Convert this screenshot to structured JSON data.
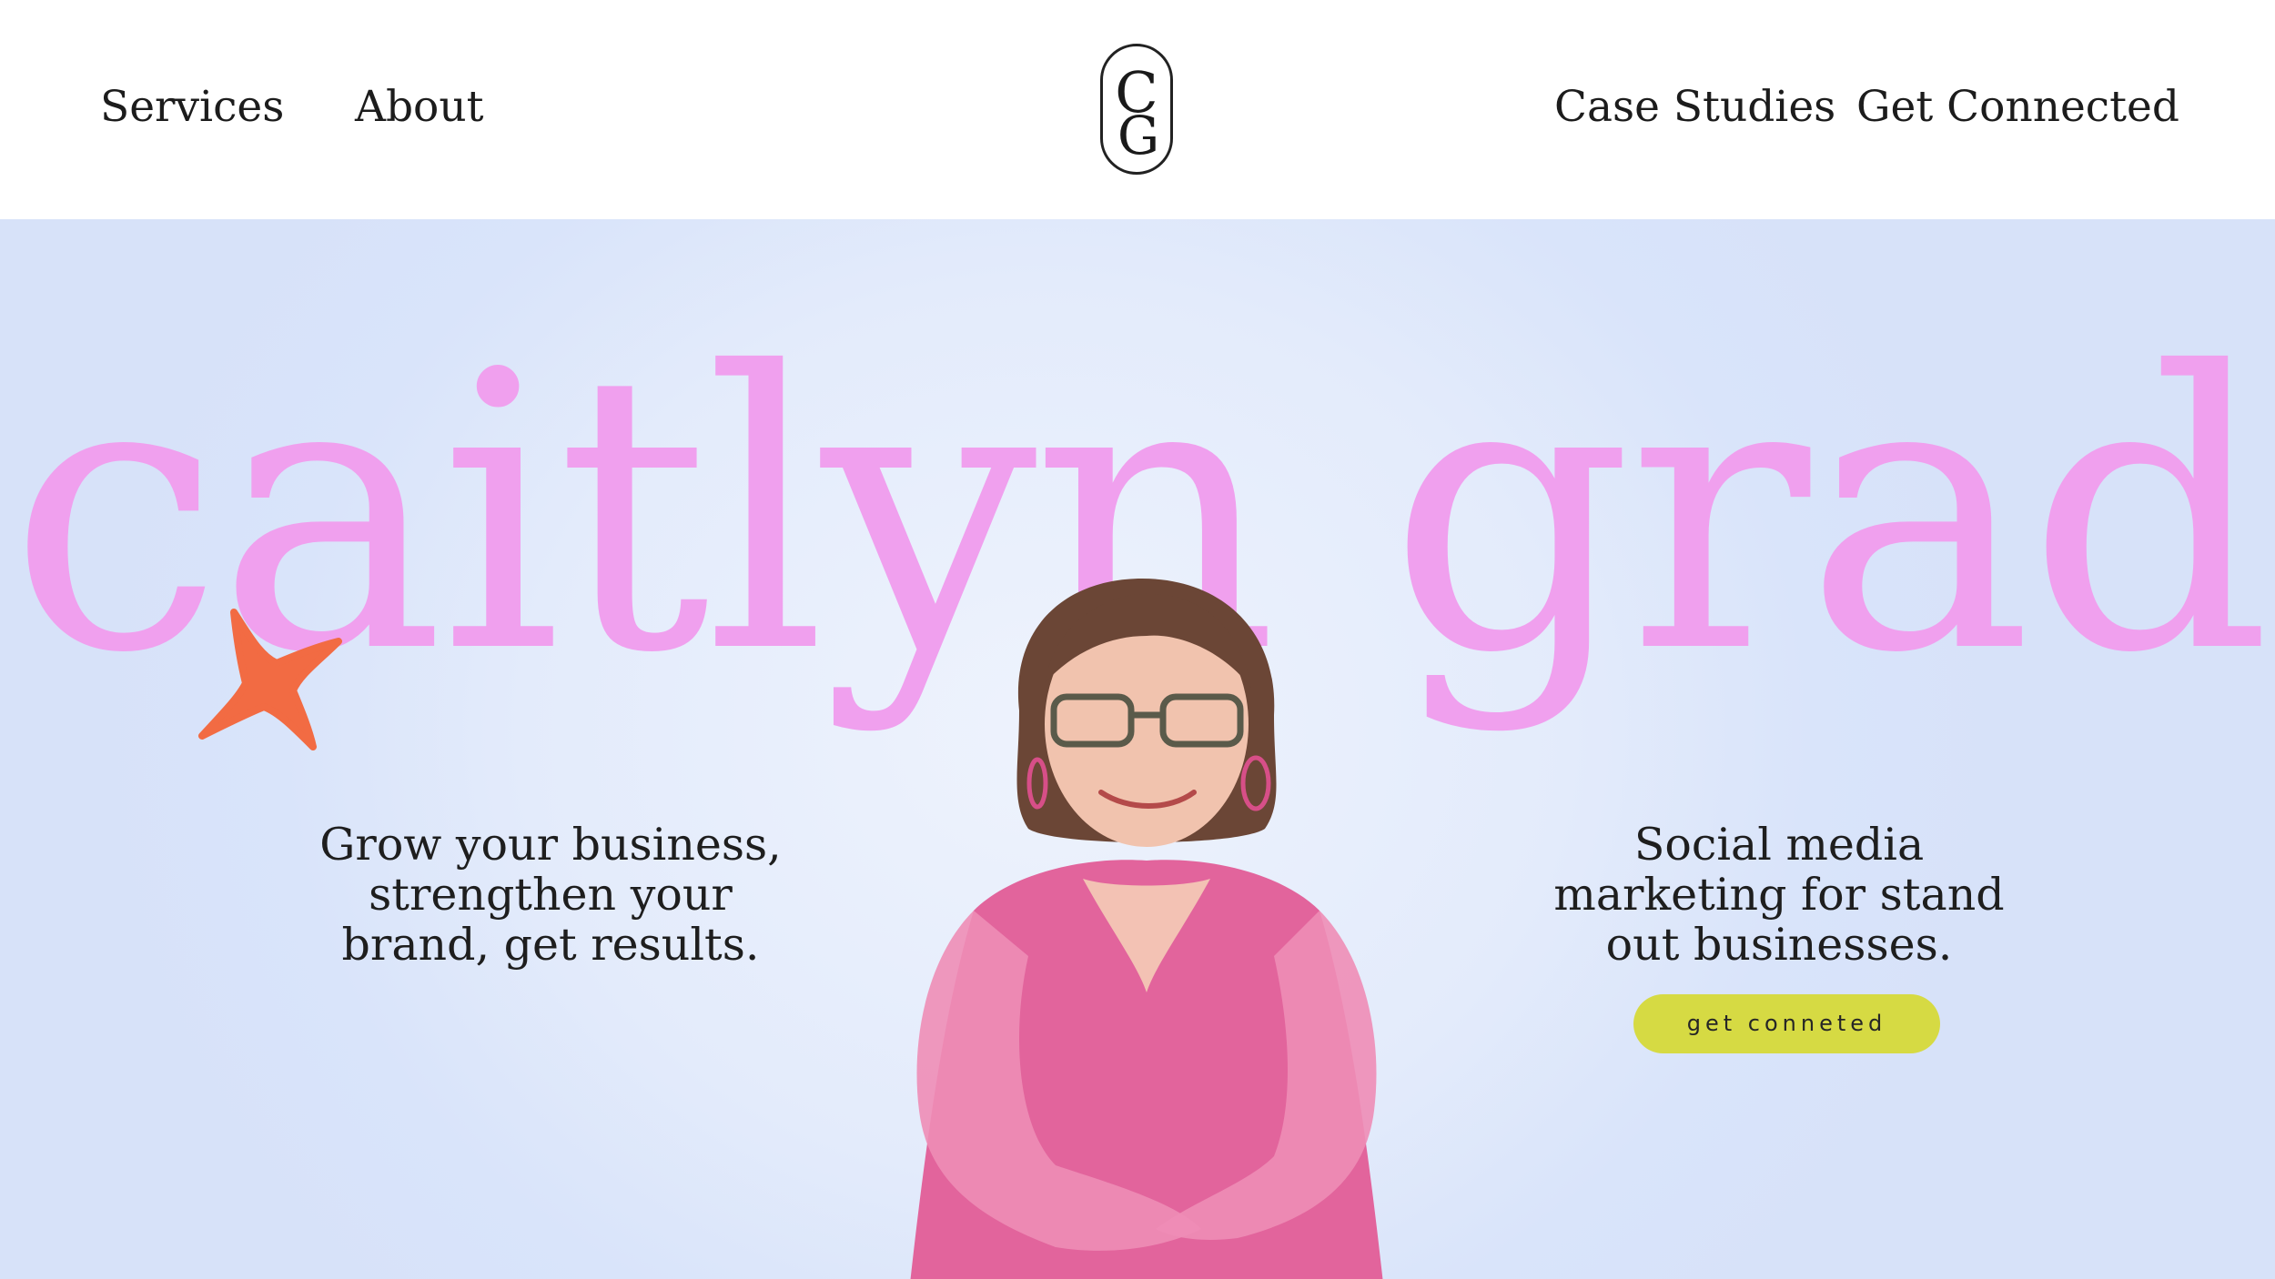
{
  "header": {
    "nav_left": [
      "Services",
      "About"
    ],
    "nav_right": [
      "Case Studies",
      "Get Connected"
    ],
    "logo_letters": [
      "C",
      "G"
    ]
  },
  "hero": {
    "title": "caitlyn grad",
    "tagline_left": [
      "Grow your business,",
      "strengthen your",
      "brand, get results."
    ],
    "tagline_right": [
      "Social media",
      "marketing for stand",
      "out businesses."
    ],
    "cta_label": "get conneted"
  },
  "colors": {
    "title_pink": "#f0a0ee",
    "sparkle_orange": "#f26b43",
    "cta_yellow": "#d6da43",
    "hero_background": "#dfe8fa"
  },
  "icons": {
    "logo": "cg-monogram-icon",
    "sparkle": "four-point-star-icon"
  }
}
